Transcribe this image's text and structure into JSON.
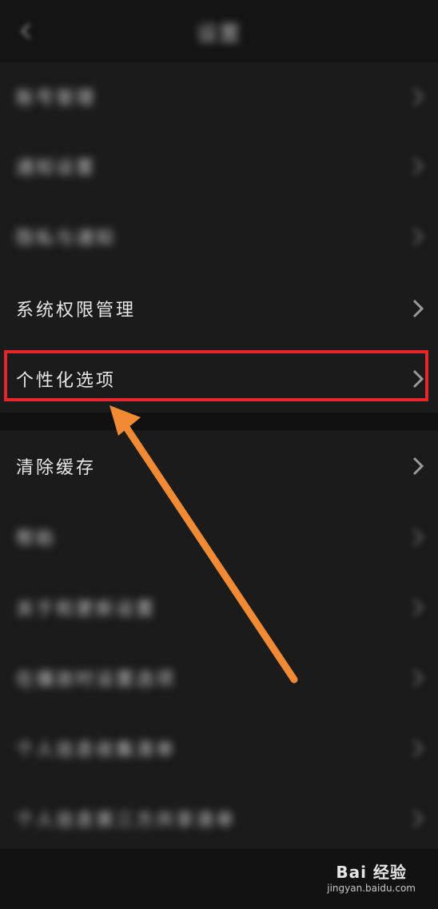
{
  "header": {
    "title": "设置",
    "back_icon": "chevron-left-icon"
  },
  "rows": [
    {
      "label": "账号管理",
      "blurred": true
    },
    {
      "label": "通知设置",
      "blurred": true
    },
    {
      "label": "隐私与通知",
      "blurred": true
    },
    {
      "label": "系统权限管理",
      "blurred": false
    },
    {
      "label": "个性化选项",
      "blurred": false,
      "highlighted": true
    },
    {
      "label": "清除缓存",
      "blurred": false
    },
    {
      "label": "帮助",
      "blurred": true
    },
    {
      "label": "关于和更新设置",
      "blurred": true
    },
    {
      "label": "在播放时设置选项",
      "blurred": true
    },
    {
      "label": "个人信息收集清单",
      "blurred": true
    },
    {
      "label": "个人信息第三方共享清单",
      "blurred": true
    }
  ],
  "annotation": {
    "arrow_color": "#f08a35",
    "box_color": "#e8262d"
  },
  "watermark": {
    "brand": "Bai 经验",
    "url": "jingyan.baidu.com"
  }
}
